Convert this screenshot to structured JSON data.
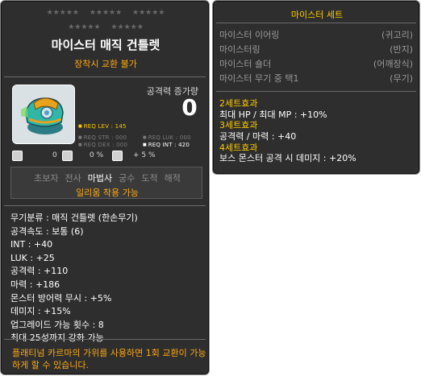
{
  "item": {
    "star_rows": [
      [
        "★★★★★",
        "★★★★★",
        "★★★★★"
      ],
      [
        "★★★★★",
        "★★★★★"
      ]
    ],
    "name": "마이스터 매직 건틀렛",
    "subtitle": "장착시 교환 불가",
    "icon": "gauntlet-icon",
    "attack_increase_label": "공격력 증가량",
    "attack_increase_value": "0",
    "requirements": {
      "level": "REQ LEV : 145",
      "str": "REQ STR : 000",
      "luk": "REQ LUK : 000",
      "dex": "REQ DEX : 000",
      "int": "REQ INT : 420"
    },
    "stat_icons": [
      {
        "icon": "crit-icon",
        "value": "0"
      },
      {
        "icon": "boss-icon",
        "value": "0 %"
      },
      {
        "icon": "ignore-icon",
        "value": "+ 5 %"
      }
    ],
    "jobs": {
      "list": [
        "초보자",
        "전사",
        "마법사",
        "궁수",
        "도적",
        "해적"
      ],
      "active": "마법사",
      "note": "일리움 착용 가능"
    },
    "stats": [
      "무기분류 : 매직 건틀렛 (한손무기)",
      "공격속도 : 보통 (6)",
      "INT : +40",
      "LUK : +25",
      "공격력 : +110",
      "마력 : +186",
      "몬스터 방어력 무시 : +5%",
      "데미지 : +15%",
      "업그레이드 가능 횟수 : 8",
      "최대 25성까지 강화 가능"
    ],
    "footer_note": "플래티넘 카르마의 가위를 사용하면 1회 교환이 가능하게 할 수 있습니다."
  },
  "set": {
    "title": "마이스터 세트",
    "parts": [
      {
        "name": "마이스터 이어링",
        "type": "(귀고리)"
      },
      {
        "name": "마이스터링",
        "type": "(반지)"
      },
      {
        "name": "마이스터 숄더",
        "type": "(어깨장식)"
      },
      {
        "name": "마이스터 무기 중 택1",
        "type": "(무기)"
      }
    ],
    "effects": [
      {
        "header": "2세트효과",
        "lines": [
          "최대 HP / 최대 MP : +10%"
        ]
      },
      {
        "header": "3세트효과",
        "lines": [
          "공격력 / 마력 : +40"
        ]
      },
      {
        "header": "4세트효과",
        "lines": [
          "보스 몬스터 공격 시 데미지 : +20%"
        ]
      }
    ]
  },
  "colors": {
    "panel_bg": "#2e2e2e",
    "highlight": "#ffaa11",
    "set_header": "#ffcc00",
    "muted": "#9a9a9a"
  }
}
